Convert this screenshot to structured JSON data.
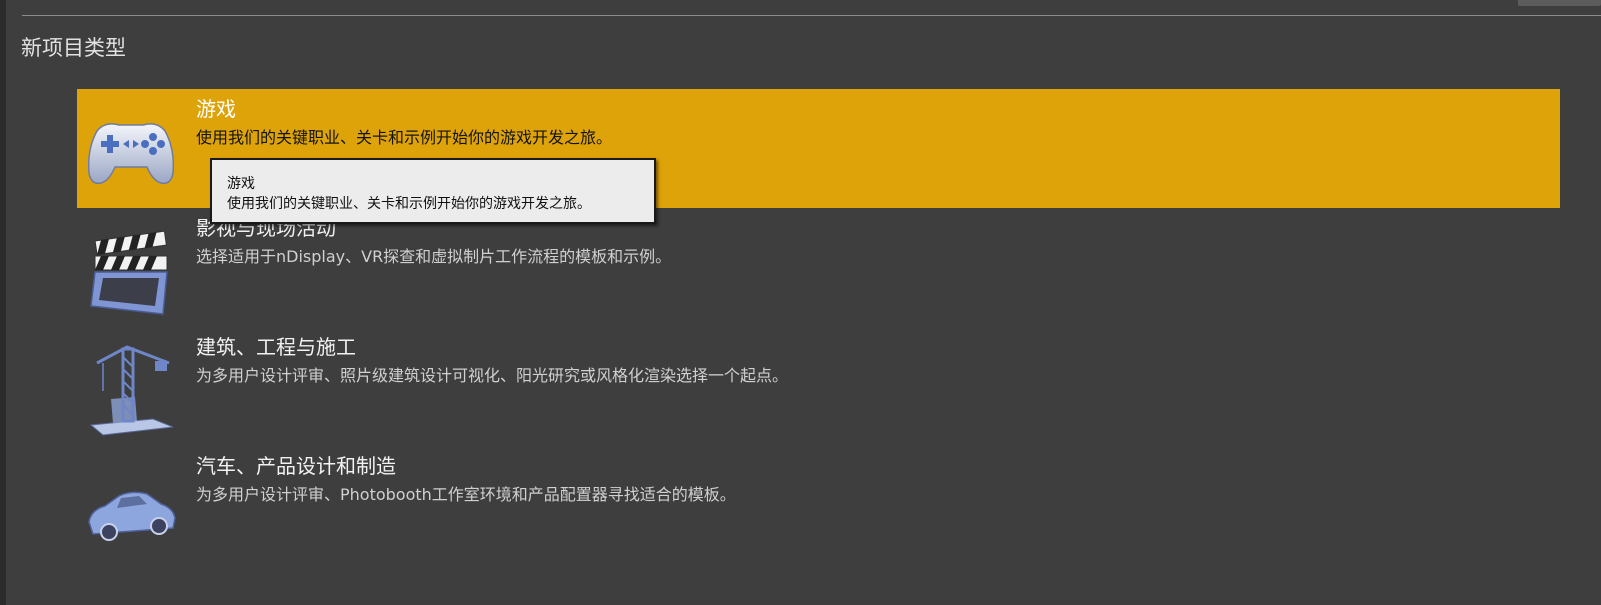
{
  "section_title": "新项目类型",
  "categories": [
    {
      "title": "游戏",
      "description": "使用我们的关键职业、关卡和示例开始你的游戏开发之旅。",
      "icon": "gamepad-icon",
      "selected": true
    },
    {
      "title": "影视与现场活动",
      "description": "选择适用于nDisplay、VR探查和虚拟制片工作流程的模板和示例。",
      "icon": "clapperboard-icon",
      "selected": false
    },
    {
      "title": "建筑、工程与施工",
      "description": "为多用户设计评审、照片级建筑设计可视化、阳光研究或风格化渲染选择一个起点。",
      "icon": "crane-icon",
      "selected": false
    },
    {
      "title": "汽车、产品设计和制造",
      "description": "为多用户设计评审、Photobooth工作室环境和产品配置器寻找适合的模板。",
      "icon": "car-icon",
      "selected": false
    }
  ],
  "tooltip": {
    "title": "游戏",
    "description": "使用我们的关键职业、关卡和示例开始你的游戏开发之旅。"
  },
  "colors": {
    "background": "#3e3e3e",
    "selected_accent": "#dea309",
    "tooltip_background": "#ececec"
  }
}
